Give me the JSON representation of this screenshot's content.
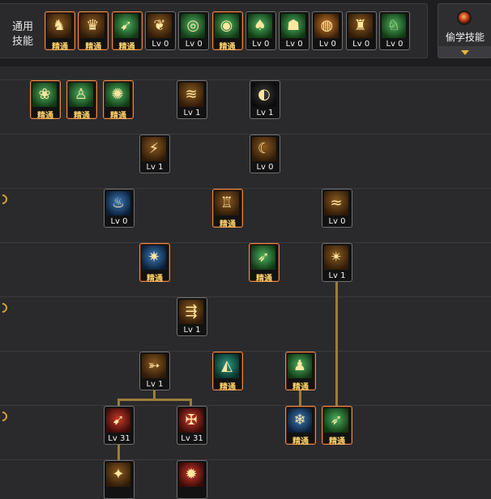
{
  "header": {
    "common_label_line1": "通用",
    "common_label_line2": "技能",
    "steal_label": "偷学技能"
  },
  "common_skills": [
    {
      "icon": "sit-figure-icon",
      "glyph": "♞",
      "level": "精通",
      "mastered": true,
      "tone": "gold"
    },
    {
      "icon": "kneel-figure-icon",
      "glyph": "♛",
      "level": "精通",
      "mastered": true,
      "tone": "gold"
    },
    {
      "icon": "dash-figure-icon",
      "glyph": "➹",
      "level": "精通",
      "mastered": true,
      "tone": "green"
    },
    {
      "icon": "wings-icon",
      "glyph": "❦",
      "level": "Lv 0",
      "mastered": false,
      "tone": "gold"
    },
    {
      "icon": "target-icon",
      "glyph": "◎",
      "level": "Lv 0",
      "mastered": false,
      "tone": "green"
    },
    {
      "icon": "radar-target-icon",
      "glyph": "◉",
      "level": "精通",
      "mastered": true,
      "tone": "green"
    },
    {
      "icon": "mushroom-icon",
      "glyph": "♠",
      "level": "Lv 0",
      "mastered": false,
      "tone": "green"
    },
    {
      "icon": "guard-figure-icon",
      "glyph": "☗",
      "level": "Lv 0",
      "mastered": false,
      "tone": "green"
    },
    {
      "icon": "eye-spiral-icon",
      "glyph": "◍",
      "level": "Lv 0",
      "mastered": false,
      "tone": "orange"
    },
    {
      "icon": "power-figure-icon",
      "glyph": "♜",
      "level": "Lv 0",
      "mastered": false,
      "tone": "gold"
    },
    {
      "icon": "leap-figure-icon",
      "glyph": "♘",
      "level": "Lv 0",
      "mastered": false,
      "tone": "green"
    }
  ],
  "tree_skills": [
    {
      "id": "s1",
      "icon": "vine-shield-icon",
      "glyph": "❀",
      "level": "精通",
      "mastered": true,
      "tone": "green"
    },
    {
      "id": "s2",
      "icon": "spirit-figure-icon",
      "glyph": "♙",
      "level": "精通",
      "mastered": true,
      "tone": "green"
    },
    {
      "id": "s3",
      "icon": "burst-figure-icon",
      "glyph": "✺",
      "level": "精通",
      "mastered": true,
      "tone": "green"
    },
    {
      "id": "s4",
      "icon": "slide-kick-icon",
      "glyph": "≋",
      "level": "Lv 1",
      "mastered": false,
      "tone": "gold"
    },
    {
      "id": "s5",
      "icon": "vortex-icon",
      "glyph": "◐",
      "level": "Lv 1",
      "mastered": false,
      "tone": "dark"
    },
    {
      "id": "s6",
      "icon": "rising-kick-icon",
      "glyph": "⚡",
      "level": "Lv 1",
      "mastered": false,
      "tone": "gold"
    },
    {
      "id": "s7",
      "icon": "crescent-slash-icon",
      "glyph": "☾",
      "level": "Lv 0",
      "mastered": false,
      "tone": "gold"
    },
    {
      "id": "s8",
      "icon": "blue-flame-icon",
      "glyph": "♨",
      "level": "Lv 0",
      "mastered": false,
      "tone": "blue"
    },
    {
      "id": "s9",
      "icon": "tower-figure-icon",
      "glyph": "♖",
      "level": "精通",
      "mastered": true,
      "tone": "gold"
    },
    {
      "id": "s10",
      "icon": "whirlwind-icon",
      "glyph": "≈",
      "level": "Lv 0",
      "mastered": false,
      "tone": "gold"
    },
    {
      "id": "s11",
      "icon": "ice-burst-icon",
      "glyph": "✷",
      "level": "精通",
      "mastered": true,
      "tone": "blue"
    },
    {
      "id": "s12",
      "icon": "spear-thrust-icon",
      "glyph": "➶",
      "level": "精通",
      "mastered": true,
      "tone": "green"
    },
    {
      "id": "s13",
      "icon": "triple-strike-icon",
      "glyph": "✴",
      "level": "Lv 1",
      "mastered": false,
      "tone": "gold"
    },
    {
      "id": "s14",
      "icon": "arrow-volley-icon",
      "glyph": "⇶",
      "level": "Lv 1",
      "mastered": false,
      "tone": "gold"
    },
    {
      "id": "s15",
      "icon": "piercing-arrow-icon",
      "glyph": "➳",
      "level": "Lv 1",
      "mastered": false,
      "tone": "gold"
    },
    {
      "id": "s16",
      "icon": "teal-dome-icon",
      "glyph": "◭",
      "level": "精通",
      "mastered": true,
      "tone": "teal"
    },
    {
      "id": "s17",
      "icon": "green-aura-figure-icon",
      "glyph": "♟",
      "level": "精通",
      "mastered": true,
      "tone": "green"
    },
    {
      "id": "s18",
      "icon": "bow-shot-icon",
      "glyph": "➹",
      "level": "Lv 31",
      "mastered": false,
      "tone": "red"
    },
    {
      "id": "s19",
      "icon": "crossbow-icon",
      "glyph": "✠",
      "level": "Lv 31",
      "mastered": false,
      "tone": "red"
    },
    {
      "id": "s20",
      "icon": "frost-nova-icon",
      "glyph": "❄",
      "level": "精通",
      "mastered": true,
      "tone": "blue"
    },
    {
      "id": "s21",
      "icon": "green-spear-icon",
      "glyph": "➶",
      "level": "精通",
      "mastered": true,
      "tone": "green"
    },
    {
      "id": "s22",
      "icon": "bottom-skill-a-icon",
      "glyph": "✦",
      "level": "",
      "mastered": false,
      "tone": "gold"
    },
    {
      "id": "s23",
      "icon": "bottom-skill-b-icon",
      "glyph": "✹",
      "level": "",
      "mastered": false,
      "tone": "red"
    }
  ]
}
